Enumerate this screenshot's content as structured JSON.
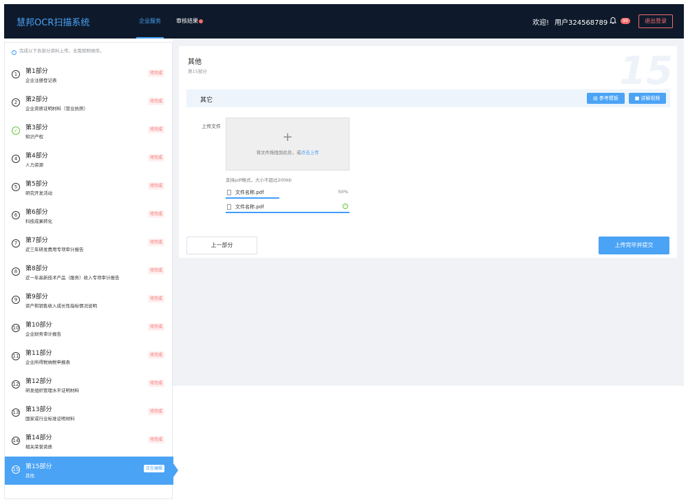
{
  "header": {
    "brand": "慧邦OCR扫描系统",
    "nav": [
      {
        "label": "企业服务",
        "active": true
      },
      {
        "label": "审核结果",
        "active": false,
        "dot": true
      }
    ],
    "welcome": "欢迎!",
    "user": "用户324568789",
    "badge": "99",
    "logout": "退出登录"
  },
  "sidebar": {
    "notice": "完成以下各部分资料上传，无需按照顺序。",
    "steps": [
      {
        "num": "1",
        "title": "第1部分",
        "sub": "企业注册登记表",
        "tag": "待完成"
      },
      {
        "num": "2",
        "title": "第2部分",
        "sub": "企业资质证明材料（营业执照）",
        "tag": "待完成"
      },
      {
        "num": "✓",
        "title": "第3部分",
        "sub": "知识产权",
        "tag": "待完成",
        "done": true
      },
      {
        "num": "4",
        "title": "第4部分",
        "sub": "人力资源",
        "tag": "待完成"
      },
      {
        "num": "5",
        "title": "第5部分",
        "sub": "研究开发活动",
        "tag": "待完成"
      },
      {
        "num": "6",
        "title": "第6部分",
        "sub": "科技成果转化",
        "tag": "待完成"
      },
      {
        "num": "7",
        "title": "第7部分",
        "sub": "近三年研发费用专项审计报告",
        "tag": "待完成"
      },
      {
        "num": "8",
        "title": "第8部分",
        "sub": "近一年高新技术产品（服务）收入专项审计报告",
        "tag": "待完成"
      },
      {
        "num": "9",
        "title": "第9部分",
        "sub": "资产和销售收入成长性指标情况说明",
        "tag": "待完成"
      },
      {
        "num": "10",
        "title": "第10部分",
        "sub": "企业财务审计报告",
        "tag": "待完成"
      },
      {
        "num": "11",
        "title": "第11部分",
        "sub": "企业所得税纳税申报表",
        "tag": "待完成"
      },
      {
        "num": "12",
        "title": "第12部分",
        "sub": "研发组织管理水平证明材料",
        "tag": "待完成"
      },
      {
        "num": "13",
        "title": "第13部分",
        "sub": "国家或行业标准证明材料",
        "tag": "待完成"
      },
      {
        "num": "14",
        "title": "第14部分",
        "sub": "相关荣誉资质",
        "tag": "待完成"
      },
      {
        "num": "15",
        "title": "第15部分",
        "sub": "其他",
        "tag": "正在编辑",
        "active": true
      }
    ]
  },
  "main": {
    "title": "其他",
    "subtitle": "第15部分",
    "bignum": "15",
    "section": "其它",
    "btn_template": "参考模板",
    "btn_video": "讲解视频",
    "upload_label": "上传文件",
    "drop_plus": "+",
    "drop_hint": "将文件拖拽到此处，或",
    "drop_link": "点击上传",
    "format_hint": "支持pdf格式，大小不超过200kb",
    "files": [
      {
        "name": "文件名称.pdf",
        "progress": "50%"
      },
      {
        "name": "文件名称.pdf",
        "status": "done"
      }
    ],
    "prev": "上一部分",
    "submit": "上传完毕并提交"
  }
}
